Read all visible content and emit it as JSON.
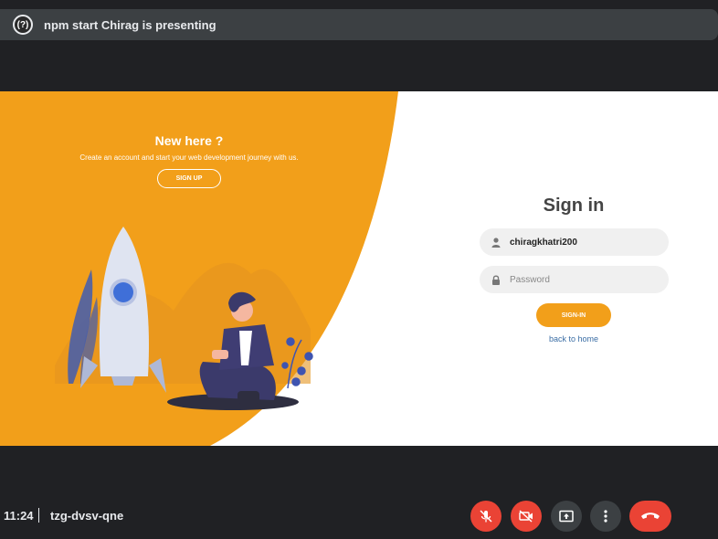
{
  "meet": {
    "presenter_initials": "(?)",
    "presenting_text": "npm start Chirag is presenting",
    "clock": "11:24",
    "meeting_code": "tzg-dvsv-qne"
  },
  "left_panel": {
    "heading": "New here ?",
    "subtext": "Create an account and start your web development journey with us.",
    "signup_label": "SIGN UP"
  },
  "signin_form": {
    "title": "Sign in",
    "username_value": "chiragkhatri200",
    "password_placeholder": "Password",
    "signin_label": "SIGN-IN",
    "back_link": "back to home"
  },
  "colors": {
    "accent_orange": "#f29f1a",
    "end_call_red": "#ea4335",
    "meet_bg": "#202124"
  },
  "icons": [
    "user-icon",
    "lock-icon",
    "mic-off-icon",
    "camera-off-icon",
    "present-screen-icon",
    "more-vert-icon",
    "end-call-icon"
  ]
}
